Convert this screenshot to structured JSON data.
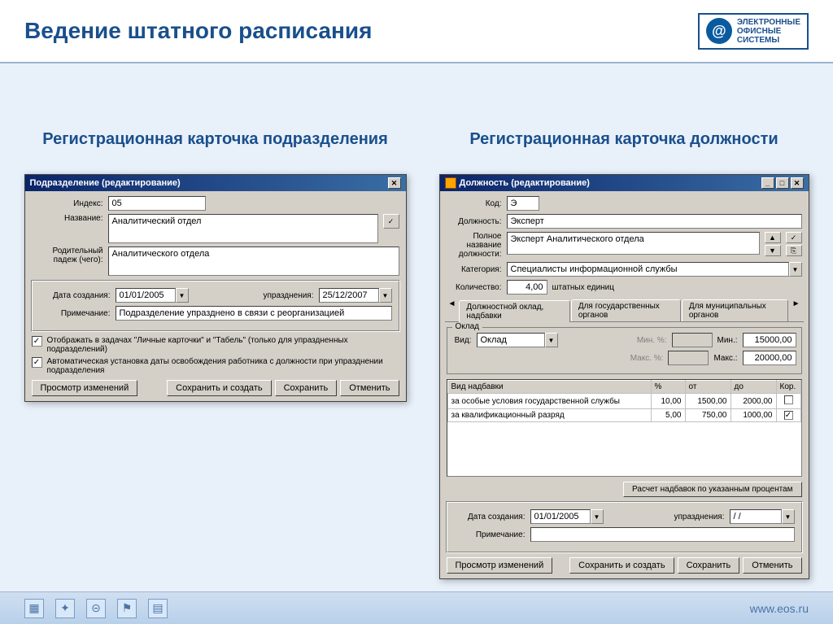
{
  "page_title": "Ведение штатного расписания",
  "logo": {
    "line1": "ЭЛЕКТРОННЫЕ",
    "line2": "ОФИСНЫЕ",
    "line3": "СИСТЕМЫ"
  },
  "subtitle_left": "Регистрационная карточка подразделения",
  "subtitle_right": "Регистрационная карточка должности",
  "w1": {
    "title": "Подразделение (редактирование)",
    "index_label": "Индекс:",
    "index_value": "05",
    "name_label": "Название:",
    "name_value": "Аналитический отдел",
    "genitive_label": "Родительный падеж (чего):",
    "genitive_value": "Аналитического отдела",
    "created_label": "Дата создания:",
    "created_value": "01/01/2005",
    "abolished_label": "упразднения:",
    "abolished_value": "25/12/2007",
    "note_label": "Примечание:",
    "note_value": "Подразделение упразднено в связи с реорганизацией",
    "chk1": "Отображать в задачах \"Личные карточки\" и \"Табель\" (только для упраздненных подразделений)",
    "chk2": "Автоматическая установка даты освобождения работника с должности при упразднении подразделения",
    "btn_view": "Просмотр изменений",
    "btn_save_create": "Сохранить и создать",
    "btn_save": "Сохранить",
    "btn_cancel": "Отменить"
  },
  "w2": {
    "title": "Должность (редактирование)",
    "code_label": "Код:",
    "code_value": "Э",
    "post_label": "Должность:",
    "post_value": "Эксперт",
    "fullname_label": "Полное название должности:",
    "fullname_value": "Эксперт  Аналитического отдела",
    "category_label": "Категория:",
    "category_value": "Специалисты информационной службы",
    "qty_label": "Количество:",
    "qty_value": "4,00",
    "qty_units": "штатных единиц",
    "tabs": [
      "Должностной оклад, надбавки",
      "Для государственных органов",
      "Для муниципальных органов"
    ],
    "salary_legend": "Оклад",
    "type_label": "Вид:",
    "type_value": "Оклад",
    "min_pct_label": "Мин. %:",
    "min_label": "Мин.:",
    "min_value": "15000,00",
    "max_pct_label": "Макс. %:",
    "max_label": "Макс.:",
    "max_value": "20000,00",
    "table_headers": [
      "Вид надбавки",
      "%",
      "от",
      "до",
      "Кор."
    ],
    "table_rows": [
      {
        "name": "за особые условия государственной службы",
        "pct": "10,00",
        "from": "1500,00",
        "to": "2000,00",
        "corr": false
      },
      {
        "name": "за квалификационный разряд",
        "pct": "5,00",
        "from": "750,00",
        "to": "1000,00",
        "corr": true
      }
    ],
    "calc_btn": "Расчет надбавок по указанным процентам",
    "created_label": "Дата создания:",
    "created_value": "01/01/2005",
    "abolished_label": "упразднения:",
    "abolished_value": "/ /",
    "note_label": "Примечание:",
    "btn_view": "Просмотр изменений",
    "btn_save_create": "Сохранить и создать",
    "btn_save": "Сохранить",
    "btn_cancel": "Отменить"
  },
  "footer_link": "www.eos.ru"
}
